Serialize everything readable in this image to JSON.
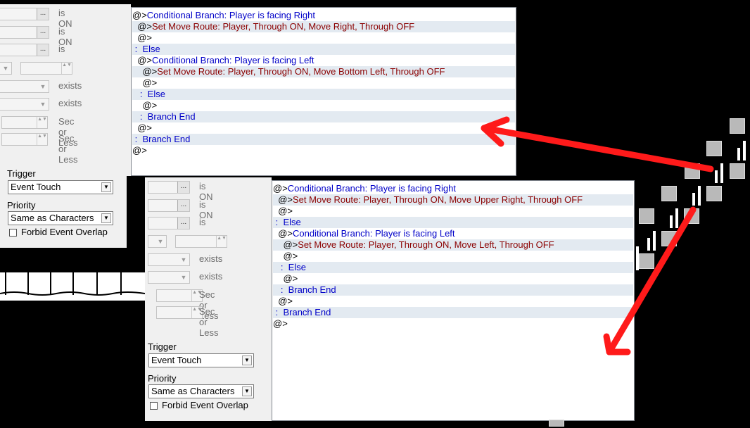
{
  "colors": {
    "branch_blue": "#0000c8",
    "route_red": "#8b0000",
    "stripe": "#e3eaf1",
    "arrow": "#ff1a1a"
  },
  "left_panel": {
    "conditions": [
      {
        "suffix": "is ON"
      },
      {
        "suffix": "is ON"
      },
      {
        "suffix": "is"
      },
      {
        "suffix": ""
      },
      {
        "suffix": "exists"
      },
      {
        "suffix": "exists"
      },
      {
        "suffix": "Sec or Less"
      },
      {
        "suffix": "Sec or Less"
      }
    ],
    "trigger": {
      "label": "Trigger",
      "value": "Event Touch"
    },
    "priority": {
      "label": "Priority",
      "value": "Same as Characters"
    },
    "forbid_overlap": {
      "label": "Forbid Event Overlap",
      "checked": false
    },
    "ellipsis": "...",
    "arrow_down": "▼",
    "spin_glyph": "▲▼"
  },
  "top_code": [
    {
      "text": "@>Conditional Branch: Player is facing Right",
      "kind": "branch"
    },
    {
      "text": "  @>Set Move Route: Player, Through ON, Move Right, Through OFF",
      "kind": "route"
    },
    {
      "text": "  @>",
      "kind": "plain"
    },
    {
      "text": " :  Else",
      "kind": "branch"
    },
    {
      "text": "  @>Conditional Branch: Player is facing Left",
      "kind": "branch"
    },
    {
      "text": "    @>Set Move Route: Player, Through ON, Move Bottom Left, Through OFF",
      "kind": "route"
    },
    {
      "text": "    @>",
      "kind": "plain"
    },
    {
      "text": "   :  Else",
      "kind": "branch"
    },
    {
      "text": "    @>",
      "kind": "plain"
    },
    {
      "text": "   :  Branch End",
      "kind": "branch"
    },
    {
      "text": "  @>",
      "kind": "plain"
    },
    {
      "text": " :  Branch End",
      "kind": "branch"
    },
    {
      "text": "@>",
      "kind": "plain"
    }
  ],
  "bottom_code": [
    {
      "text": "@>Conditional Branch: Player is facing Right",
      "kind": "branch"
    },
    {
      "text": "  @>Set Move Route: Player, Through ON, Move Upper Right, Through OFF",
      "kind": "route"
    },
    {
      "text": "  @>",
      "kind": "plain"
    },
    {
      "text": " :  Else",
      "kind": "branch"
    },
    {
      "text": "  @>Conditional Branch: Player is facing Left",
      "kind": "branch"
    },
    {
      "text": "    @>Set Move Route: Player, Through ON, Move Left, Through OFF",
      "kind": "route"
    },
    {
      "text": "    @>",
      "kind": "plain"
    },
    {
      "text": "   :  Else",
      "kind": "branch"
    },
    {
      "text": "    @>",
      "kind": "plain"
    },
    {
      "text": "   :  Branch End",
      "kind": "branch"
    },
    {
      "text": "  @>",
      "kind": "plain"
    },
    {
      "text": " :  Branch End",
      "kind": "branch"
    },
    {
      "text": "@>",
      "kind": "plain"
    }
  ]
}
